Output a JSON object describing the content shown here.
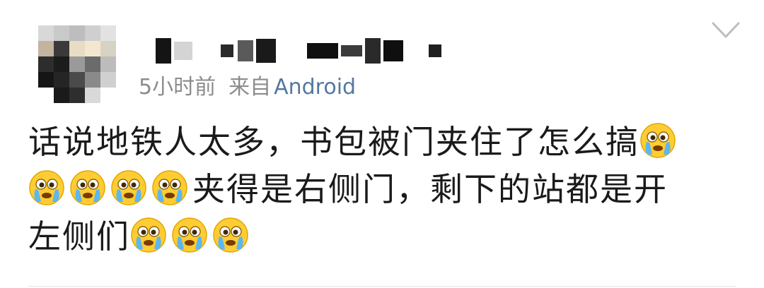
{
  "post": {
    "time_label": "5小时前",
    "from_label": "来自",
    "device_label": "Android",
    "text_line1": "话说地铁人太多，书包被门夹住了怎么搞",
    "text_line2": "夹得是右侧门，剩下的站都是开",
    "text_line3": "左侧们"
  },
  "icons": {
    "emoji": "crying-face-icon",
    "menu": "chevron-down-icon"
  },
  "colors": {
    "meta_text": "#8c8c8c",
    "device_link": "#55789e",
    "body_text": "#1a1a1a"
  }
}
